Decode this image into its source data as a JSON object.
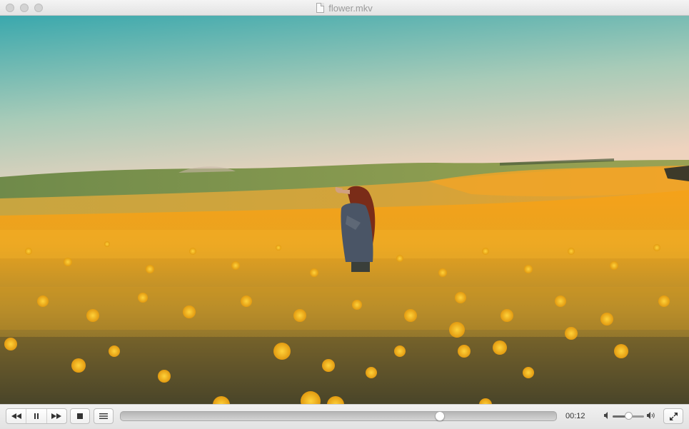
{
  "window": {
    "title": "flower.mkv"
  },
  "icons": {
    "close": "close-icon",
    "minimize": "minimize-icon",
    "zoom": "zoom-icon",
    "document": "document-icon",
    "rewind": "rewind-icon",
    "pause": "pause-icon",
    "fast_forward": "fast-forward-icon",
    "stop": "stop-icon",
    "playlist": "playlist-icon",
    "volume_low": "volume-low-icon",
    "volume_high": "volume-high-icon",
    "fullscreen": "fullscreen-icon"
  },
  "playback": {
    "elapsed_time": "00:12",
    "progress": 0.738,
    "volume": 0.5
  },
  "colors": {
    "sky_top": "#3aa8ad",
    "sky_bottom": "#e6d2bf",
    "field": "#f2a21a"
  }
}
